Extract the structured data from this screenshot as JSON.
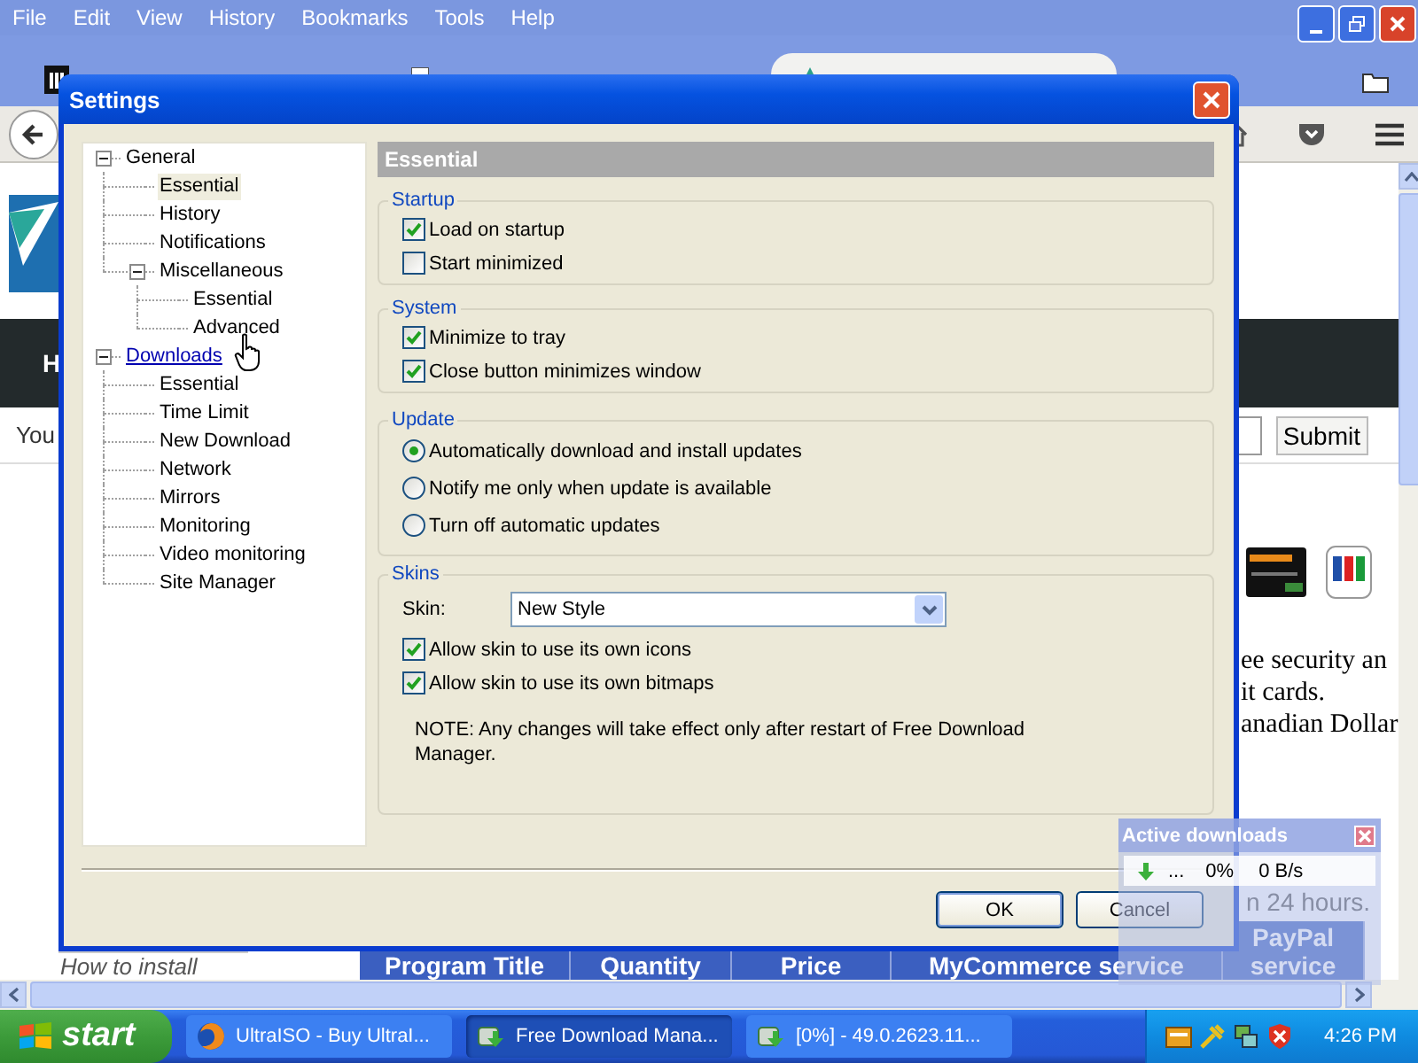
{
  "browser": {
    "menu": [
      "File",
      "Edit",
      "View",
      "History",
      "Bookmarks",
      "Tools",
      "Help"
    ],
    "page": {
      "heading_letter": "H",
      "form_label": "You",
      "submit": "Submit",
      "text_lines": [
        "ee security an",
        "it cards.",
        "anadian Dollar"
      ],
      "partial_text": "n 24 hours.",
      "install_link": "How to install",
      "table_headers": [
        "Program Title",
        "Quantity",
        "Price",
        "MyCommerce service",
        "PayPal service"
      ]
    }
  },
  "dialog": {
    "title": "Settings",
    "tree": [
      {
        "label": "General",
        "selected": false,
        "hovered": false,
        "expanded": true,
        "children": [
          {
            "label": "Essential",
            "selected": true,
            "hovered": false
          },
          {
            "label": "History",
            "selected": false,
            "hovered": false
          },
          {
            "label": "Notifications",
            "selected": false,
            "hovered": false
          },
          {
            "label": "Miscellaneous",
            "selected": false,
            "hovered": false,
            "expanded": true,
            "children": [
              {
                "label": "Essential",
                "selected": false,
                "hovered": false
              },
              {
                "label": "Advanced",
                "selected": false,
                "hovered": false
              }
            ]
          }
        ]
      },
      {
        "label": "Downloads",
        "selected": false,
        "hovered": true,
        "expanded": true,
        "children": [
          {
            "label": "Essential",
            "selected": false,
            "hovered": false
          },
          {
            "label": "Time Limit",
            "selected": false,
            "hovered": false
          },
          {
            "label": "New Download",
            "selected": false,
            "hovered": false
          },
          {
            "label": "Network",
            "selected": false,
            "hovered": false
          },
          {
            "label": "Mirrors",
            "selected": false,
            "hovered": false
          },
          {
            "label": "Monitoring",
            "selected": false,
            "hovered": false
          },
          {
            "label": "Video monitoring",
            "selected": false,
            "hovered": false
          },
          {
            "label": "Site Manager",
            "selected": false,
            "hovered": false
          }
        ]
      }
    ],
    "panel": {
      "title": "Essential",
      "groups": [
        {
          "title": "Startup",
          "items": [
            {
              "kind": "checkbox",
              "label": "Load on startup",
              "checked": true
            },
            {
              "kind": "checkbox",
              "label": "Start minimized",
              "checked": false
            }
          ]
        },
        {
          "title": "System",
          "items": [
            {
              "kind": "checkbox",
              "label": "Minimize to tray",
              "checked": true
            },
            {
              "kind": "checkbox",
              "label": "Close button minimizes window",
              "checked": true
            }
          ]
        },
        {
          "title": "Update",
          "items": [
            {
              "kind": "radio",
              "label": "Automatically download and install updates",
              "selected": true
            },
            {
              "kind": "radio",
              "label": "Notify me only when update is available",
              "selected": false
            },
            {
              "kind": "radio",
              "label": "Turn off automatic updates",
              "selected": false
            }
          ]
        },
        {
          "title": "Skins",
          "items": [
            {
              "kind": "select",
              "label": "Skin:",
              "value": "New Style"
            },
            {
              "kind": "checkbox",
              "label": "Allow skin to use its own icons",
              "checked": true
            },
            {
              "kind": "checkbox",
              "label": "Allow skin to use its own bitmaps",
              "checked": true
            },
            {
              "kind": "note",
              "text": "NOTE: Any changes will take effect only after restart of Free Download Manager."
            }
          ]
        }
      ]
    },
    "buttons": [
      {
        "label": "OK",
        "default": true
      },
      {
        "label": "Cancel",
        "default": false
      }
    ]
  },
  "popup": {
    "title": "Active downloads",
    "name": "...",
    "percent": "0%",
    "speed": "0 B/s"
  },
  "taskbar": {
    "start": "start",
    "tasks": [
      {
        "label": "UltraISO - Buy UltraI...",
        "selected": false,
        "kind": "browser"
      },
      {
        "label": "Free Download Mana...",
        "selected": true,
        "kind": "downloader"
      },
      {
        "label": "[0%] - 49.0.2623.11...",
        "selected": false,
        "kind": "downloader"
      }
    ],
    "clock": "4:26 PM"
  }
}
